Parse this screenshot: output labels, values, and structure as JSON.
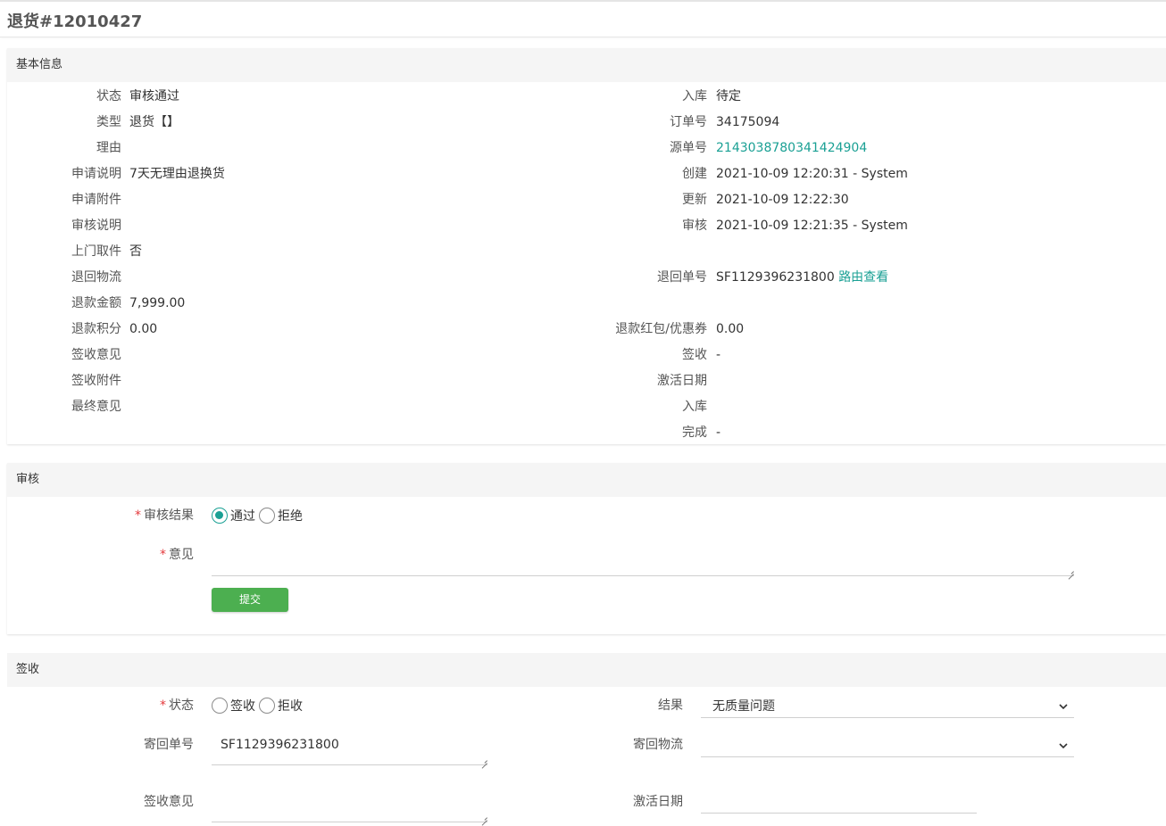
{
  "page": {
    "title": "退货#12010427"
  },
  "basic": {
    "header": "基本信息",
    "left": [
      {
        "label": "状态",
        "value": "审核通过"
      },
      {
        "label": "类型",
        "value": "退货【】"
      },
      {
        "label": "理由",
        "value": ""
      },
      {
        "label": "申请说明",
        "value": "7天无理由退换货"
      },
      {
        "label": "申请附件",
        "value": ""
      },
      {
        "label": "审核说明",
        "value": ""
      },
      {
        "label": "上门取件",
        "value": "否"
      },
      {
        "label": "退回物流",
        "value": ""
      },
      {
        "label": "退款金额",
        "value": "7,999.00"
      },
      {
        "label": "退款积分",
        "value": "0.00"
      },
      {
        "label": "签收意见",
        "value": ""
      },
      {
        "label": "签收附件",
        "value": ""
      },
      {
        "label": "最终意见",
        "value": ""
      }
    ],
    "right": {
      "stock": {
        "label": "入库",
        "value": "待定"
      },
      "order_no": {
        "label": "订单号",
        "value": "34175094"
      },
      "source_no": {
        "label": "源单号",
        "value": "2143038780341424904"
      },
      "created": {
        "label": "创建",
        "value": "2021-10-09 12:20:31 - System"
      },
      "updated": {
        "label": "更新",
        "value": "2021-10-09 12:22:30"
      },
      "audited": {
        "label": "审核",
        "value": "2021-10-09 12:21:35 - System"
      },
      "return_no": {
        "label": "退回单号",
        "value": "SF1129396231800",
        "link": "路由查看"
      },
      "refund_coupon": {
        "label": "退款红包/优惠券",
        "value": "0.00"
      },
      "signed": {
        "label": "签收",
        "value": "-"
      },
      "activation": {
        "label": "激活日期",
        "value": ""
      },
      "stock2": {
        "label": "入库",
        "value": ""
      },
      "done": {
        "label": "完成",
        "value": "-"
      }
    }
  },
  "audit": {
    "header": "审核",
    "result_label": "审核结果",
    "options": [
      "通过",
      "拒绝"
    ],
    "selected": "通过",
    "opinion_label": "意见",
    "opinion_value": "",
    "submit_label": "提交"
  },
  "sign": {
    "header": "签收",
    "status_label": "状态",
    "status_options": [
      "签收",
      "拒收"
    ],
    "result_label": "结果",
    "result_value": "无质量问题",
    "return_no_label": "寄回单号",
    "return_no_value": "SF1129396231800",
    "return_logistics_label": "寄回物流",
    "return_logistics_value": "",
    "sign_opinion_label": "签收意见",
    "sign_opinion_value": "",
    "activation_label": "激活日期",
    "activation_value": ""
  },
  "colors": {
    "link": "#1aa094",
    "submit": "#4caf50",
    "required": "#e4393c",
    "header_bg": "#f5f5f5"
  }
}
